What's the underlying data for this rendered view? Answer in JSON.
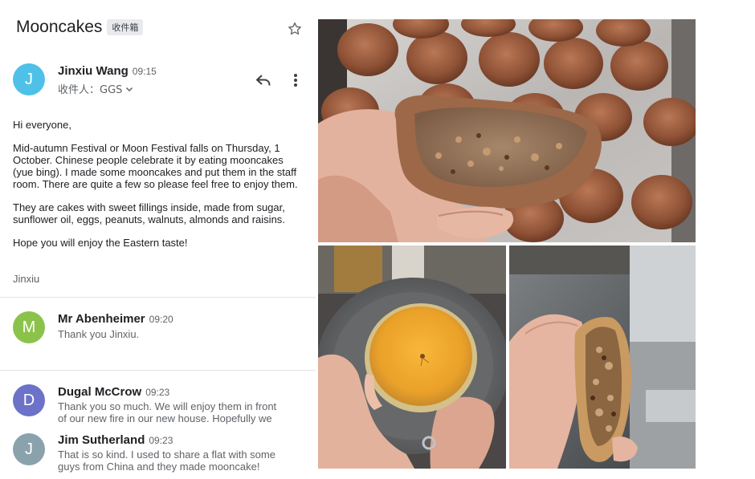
{
  "thread": {
    "subject": "Mooncakes",
    "label": "收件箱"
  },
  "first_message": {
    "sender": "Jinxiu Wang",
    "time": "09:15",
    "avatar_letter": "J",
    "recipient_label": "收件人：GGS",
    "greeting": "Hi everyone,",
    "paragraph1": "Mid-autumn Festival or Moon Festival falls on Thursday, 1 October. Chinese people celebrate it by eating mooncakes (yue bing). I made some mooncakes and put them in the staff room. There are quite a few so please feel free to enjoy them.",
    "paragraph2": "They are cakes with sweet fillings inside, made from sugar, sunflower oil, eggs, peanuts, walnuts, almonds and raisins.",
    "paragraph3": "Hope you will enjoy the Eastern taste!",
    "signature": "Jinxiu"
  },
  "replies": [
    {
      "avatar_letter": "M",
      "sender": "Mr Abenheimer",
      "time": "09:20",
      "snippet_lines": [
        "Thank you Jinxiu."
      ]
    },
    {
      "avatar_letter": "D",
      "sender": "Dugal McCrow",
      "time": "09:23",
      "snippet_lines": [
        "Thank you so much. We will enjoy them in front",
        "of our new fire in our new house. Hopefully we"
      ]
    },
    {
      "avatar_letter": "J",
      "sender": "Jim Sutherland",
      "time": "09:23",
      "snippet_lines": [
        "That is so kind. I used to share a flat with some",
        "guys from China and they made mooncake!"
      ]
    }
  ],
  "colors": {
    "avatar_first": "#4fc1e8",
    "avatar_mr": "#8bc34a",
    "avatar_dugal": "#6b72c8",
    "avatar_jim": "#8aa2ac"
  },
  "icons": [
    "star-icon",
    "reply-icon",
    "more-vert-icon",
    "chevron-down-icon"
  ]
}
